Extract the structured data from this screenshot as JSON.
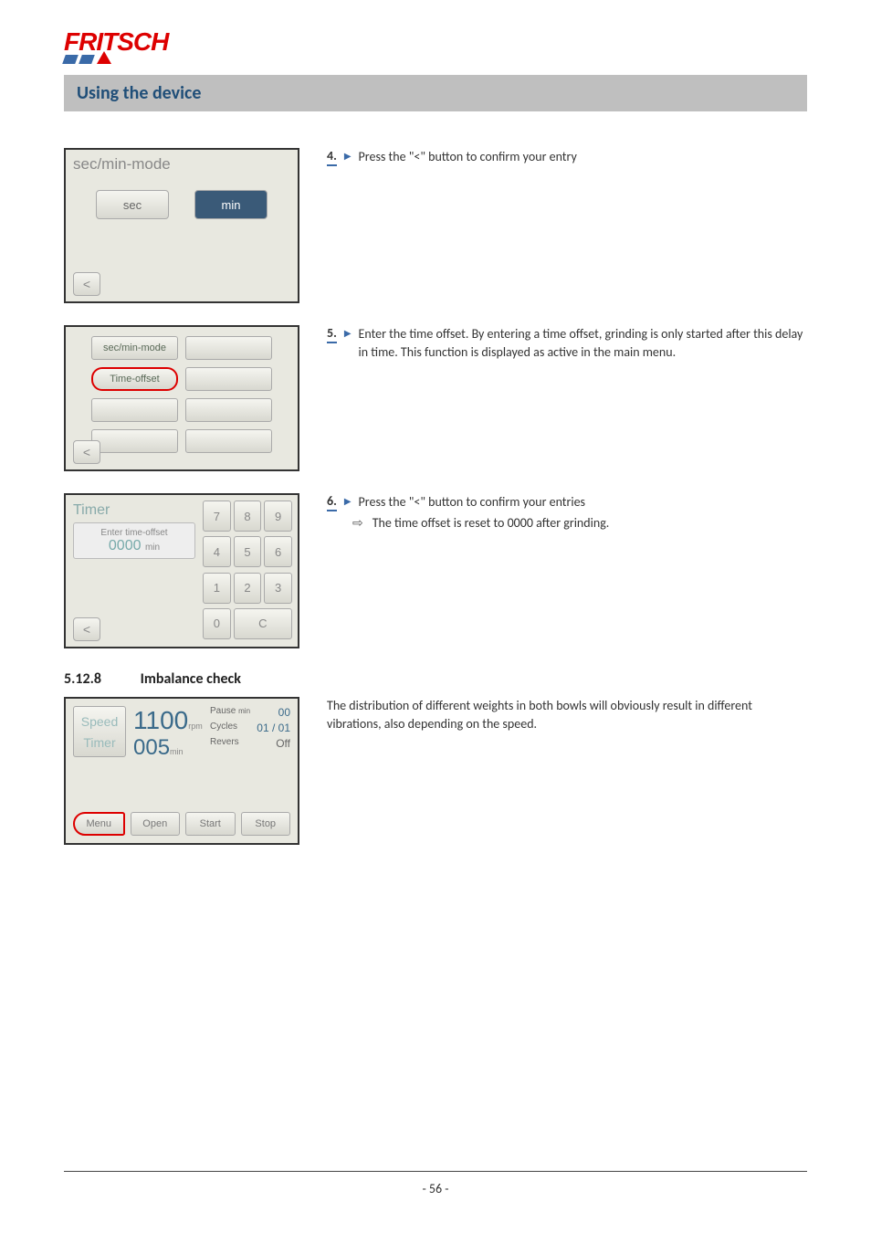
{
  "logo": {
    "text": "FRITSCH"
  },
  "section_title": "Using the device",
  "steps": {
    "s4": {
      "num": "4.",
      "text": "Press the \"<\" button to confirm your entry"
    },
    "s5": {
      "num": "5.",
      "text": "Enter the time offset. By entering a time offset, grinding is only started after this delay in time. This function is displayed as active in the main menu."
    },
    "s6": {
      "num": "6.",
      "text": "Press the \"<\" button to confirm your entries",
      "result": "The time offset is reset to 0000 after grinding."
    }
  },
  "subsection": {
    "num": "5.12.8",
    "title": "Imbalance check"
  },
  "subsection_text": "The distribution of different weights in both bowls will obviously result in different vibrations, also depending on the speed.",
  "screen1": {
    "title": "sec/min-mode",
    "btn_sec": "sec",
    "btn_min": "min",
    "back": "<"
  },
  "screen2": {
    "btn1": "sec/min-mode",
    "btn2": "Time-offset",
    "back": "<"
  },
  "screen3": {
    "title": "Timer",
    "sublabel": "Enter time-offset",
    "value": "0000",
    "unit": "min",
    "keys": [
      "7",
      "8",
      "9",
      "4",
      "5",
      "6",
      "1",
      "2",
      "3",
      "0",
      "C"
    ],
    "back": "<"
  },
  "screen4": {
    "label_speed": "Speed",
    "label_timer": "Timer",
    "speed_val": "1100",
    "speed_unit": "rpm",
    "timer_val": "005",
    "timer_unit": "min",
    "right": {
      "pause_label": "Pause",
      "pause_unit": "min",
      "pause_val": "00",
      "cycles_label": "Cycles",
      "cycles_val": "01 / 01",
      "revers_label": "Revers",
      "revers_val": "Off"
    },
    "buttons": {
      "menu": "Menu",
      "open": "Open",
      "start": "Start",
      "stop": "Stop"
    }
  },
  "page_number": "- 56 -"
}
